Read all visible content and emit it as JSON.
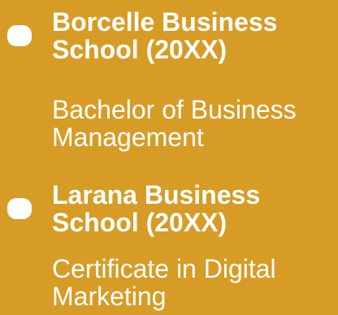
{
  "entries": [
    {
      "school_line1": "Borcelle Business",
      "school_line2": "School (20XX)",
      "degree_line1": "Bachelor of Business",
      "degree_line2": "Management"
    },
    {
      "school_line1": "Larana Business",
      "school_line2": "School (20XX)",
      "degree_line1": "Certificate in Digital",
      "degree_line2": "Marketing"
    }
  ],
  "colors": {
    "background": "#D69C26",
    "text": "#FFFFFF"
  }
}
